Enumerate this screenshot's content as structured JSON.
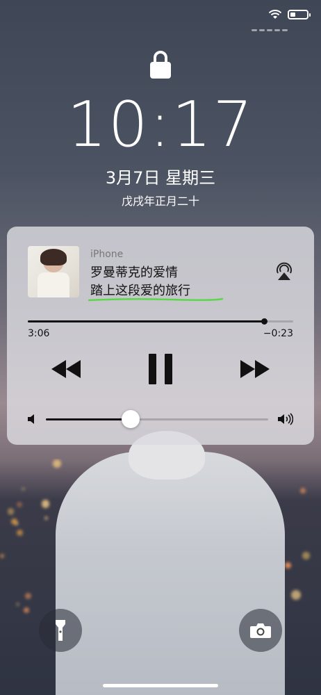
{
  "status_bar": {
    "wifi_icon": "wifi-icon",
    "battery_icon": "battery-icon"
  },
  "lock_screen": {
    "lock_icon": "lock-icon",
    "time": "10:17",
    "date": "3月7日 星期三",
    "lunar_date": "戊戌年正月二十"
  },
  "now_playing": {
    "device": "iPhone",
    "track_title": "罗曼蒂克的爱情",
    "album_title": "踏上这段爱的旅行",
    "elapsed": "3:06",
    "remaining": "−0:23",
    "progress_fraction": 0.89,
    "volume_fraction": 0.38,
    "accent_underline_color": "#5bd84a",
    "icons": [
      "airplay-icon",
      "rewind-icon",
      "pause-icon",
      "fast-forward-icon",
      "volume-low-icon",
      "volume-high-icon"
    ]
  },
  "bottom_controls": {
    "flashlight_icon": "flashlight-icon",
    "camera_icon": "camera-icon"
  }
}
